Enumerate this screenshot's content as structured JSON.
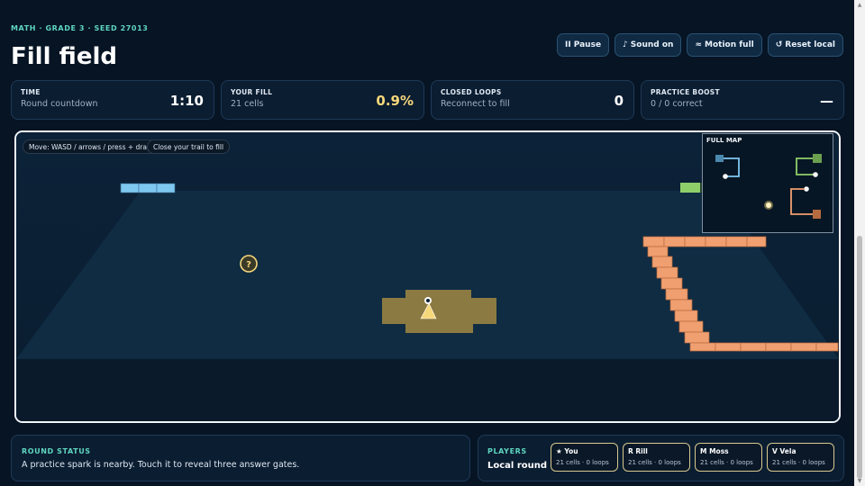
{
  "header": {
    "eyebrow": "MATH · GRADE 3 · SEED 27013",
    "title": "Fill field"
  },
  "controls": [
    {
      "icon": "pause-icon",
      "glyph": "II",
      "label": "Pause"
    },
    {
      "icon": "music-note-icon",
      "glyph": "♪",
      "label": "Sound on"
    },
    {
      "icon": "motion-icon",
      "glyph": "≈",
      "label": "Motion full"
    },
    {
      "icon": "reset-icon",
      "glyph": "↺",
      "label": "Reset local"
    }
  ],
  "stats": [
    {
      "label": "TIME",
      "sub": "Round countdown",
      "value": "1:10"
    },
    {
      "label": "YOUR FILL",
      "sub": "21 cells",
      "value": "0.9%"
    },
    {
      "label": "CLOSED LOOPS",
      "sub": "Reconnect to fill",
      "value": "0"
    },
    {
      "label": "PRACTICE BOOST",
      "sub": "0 / 0 correct",
      "value": "—"
    }
  ],
  "arena": {
    "hints": [
      "Move: WASD / arrows / press + drag",
      "Close your trail to fill"
    ],
    "spark_glyph": "?",
    "minimap_label": "FULL MAP"
  },
  "round_status": {
    "title": "ROUND STATUS",
    "text": "A practice spark is nearby. Touch it to reveal three answer gates."
  },
  "players": {
    "title": "PLAYERS",
    "subtitle": "Local round",
    "list": [
      {
        "name": "★ You",
        "stats": "21 cells · 0 loops"
      },
      {
        "name": "R Rill",
        "stats": "21 cells · 0 loops"
      },
      {
        "name": "M Moss",
        "stats": "21 cells · 0 loops"
      },
      {
        "name": "V Vela",
        "stats": "21 cells · 0 loops"
      }
    ]
  },
  "colors": {
    "accent": "#5fd6c0",
    "you": "#f6d77a",
    "rill": "#7ec8f0",
    "moss": "#8fcf6a",
    "vela": "#f0a070"
  }
}
